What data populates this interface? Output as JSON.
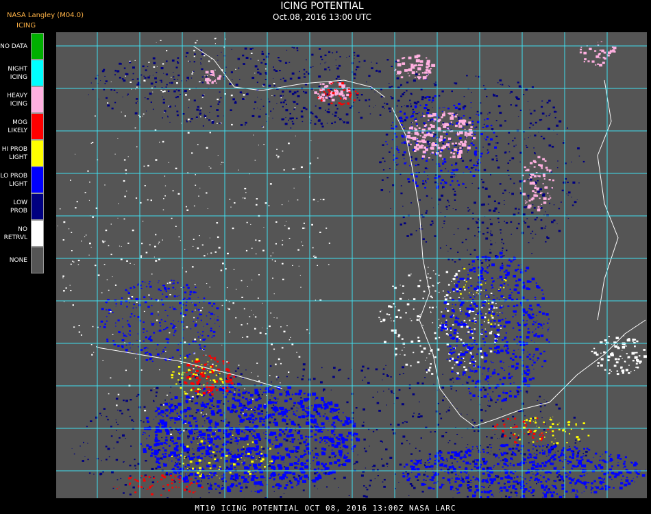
{
  "header": {
    "credit": "NASA Langley (M04.0)",
    "product": "ICING",
    "title": "ICING POTENTIAL",
    "subtitle": "Oct.08, 2016 13:00 UTC"
  },
  "legend": [
    {
      "label": "NO DATA",
      "color": "#00b000"
    },
    {
      "label": "NIGHT\nICING",
      "color": "#00ffff"
    },
    {
      "label": "HEAVY\nICING",
      "color": "#ffb0e0"
    },
    {
      "label": "MOG\nLIKELY",
      "color": "#ff0000"
    },
    {
      "label": "HI PROB\nLIGHT",
      "color": "#ffff00"
    },
    {
      "label": "LO PROB\nLIGHT",
      "color": "#0000ff"
    },
    {
      "label": "LOW\nPROB",
      "color": "#000080"
    },
    {
      "label": "NO\nRETRVL",
      "color": "#ffffff"
    },
    {
      "label": "NONE",
      "color": "#555555"
    }
  ],
  "footer": "MT10  ICING POTENTIAL   OCT 08, 2016 13:00Z   NASA LARC",
  "colors": {
    "grid": "#40e0f0",
    "background": "#555555",
    "coast": "#ffffff",
    "grid_label": "#cc0000"
  }
}
